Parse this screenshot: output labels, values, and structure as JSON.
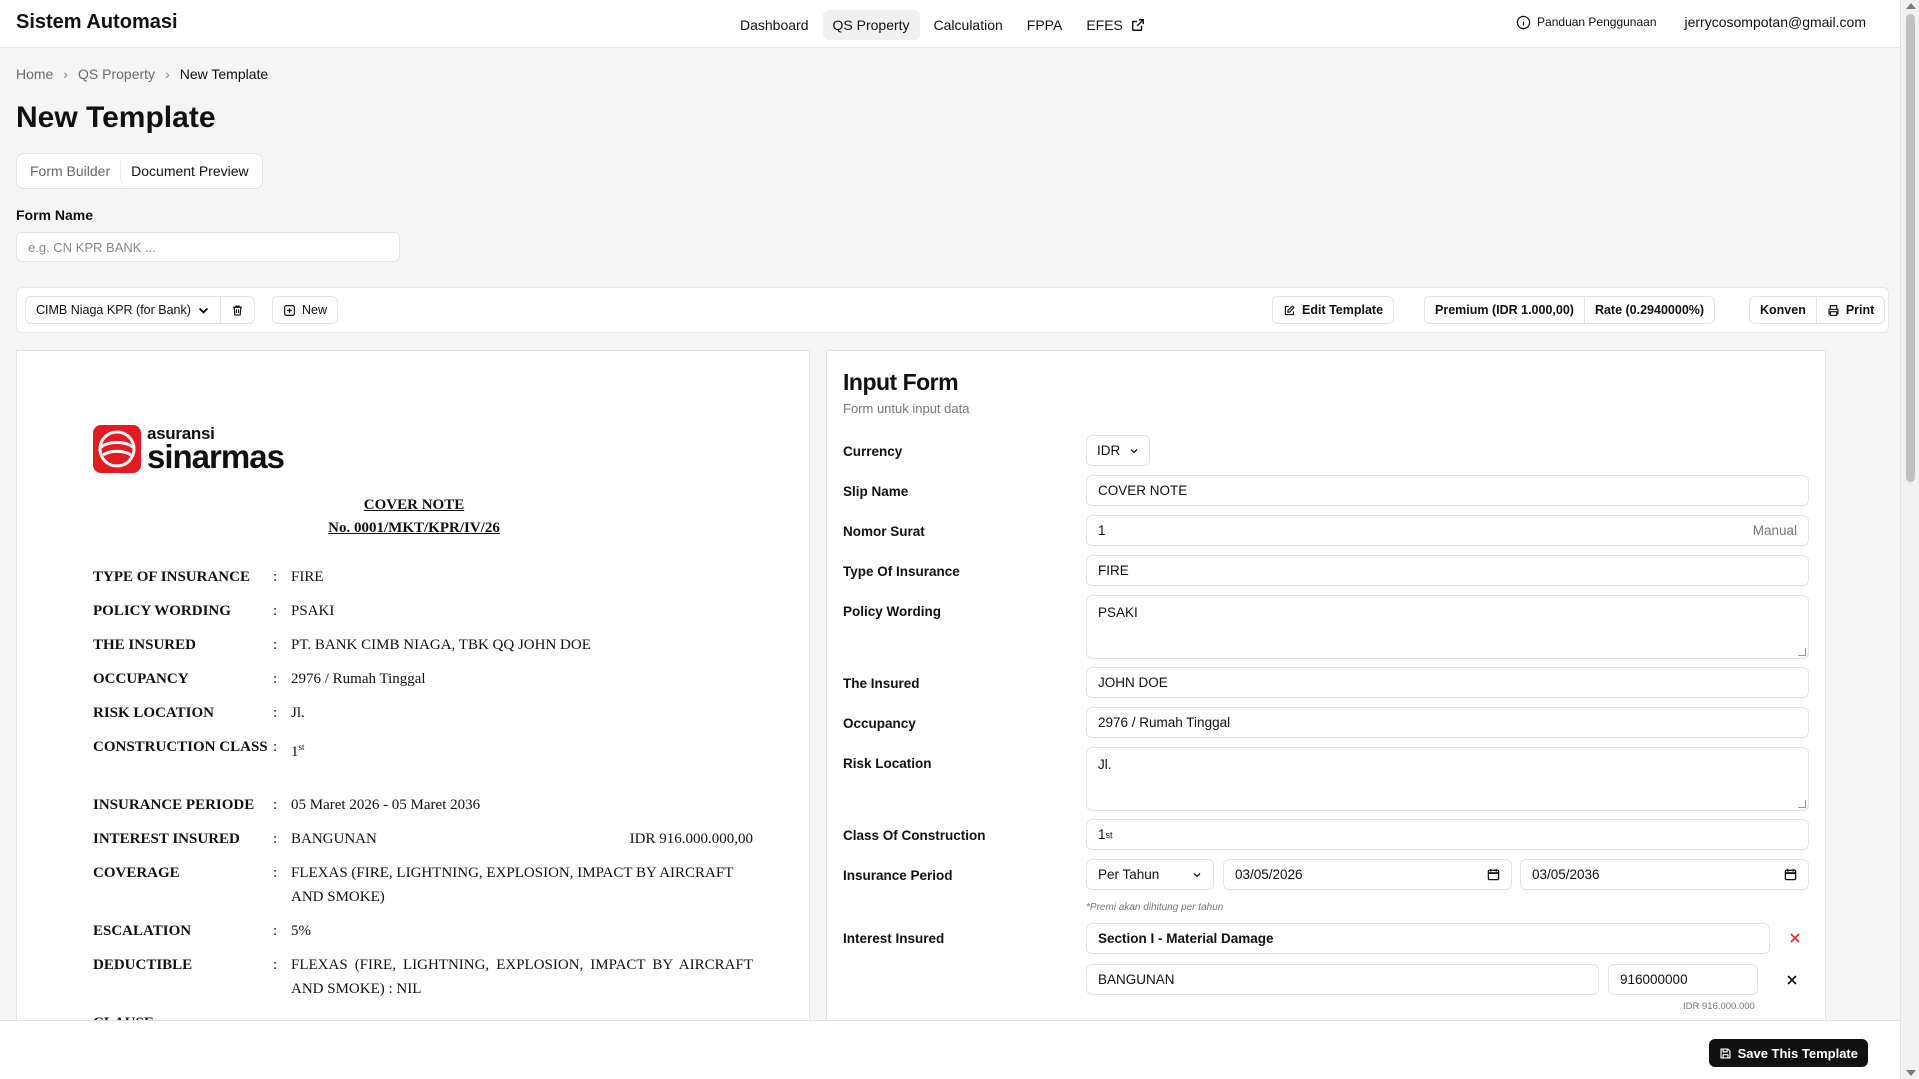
{
  "app": {
    "brand": "Sistem Automasi",
    "nav": [
      {
        "label": "Dashboard"
      },
      {
        "label": "QS Property"
      },
      {
        "label": "Calculation"
      },
      {
        "label": "FPPA"
      },
      {
        "label": "EFES"
      }
    ],
    "guide": "Panduan Penggunaan",
    "user": "jerrycosompotan@gmail.com"
  },
  "breadcrumb": [
    "Home",
    "QS Property",
    "New Template"
  ],
  "page_title": "New Template",
  "tabs": [
    "Form Builder",
    "Document Preview"
  ],
  "form_name": {
    "label": "Form Name",
    "placeholder": "e.g. CN KPR BANK ..."
  },
  "toolbar": {
    "template_select": "CIMB Niaga KPR (for Bank)",
    "new": "New",
    "edit": "Edit Template",
    "premium": "Premium (IDR 1.000,00)",
    "rate": "Rate (0.2940000%)",
    "konven": "Konven",
    "print": "Print"
  },
  "document": {
    "logo_small": "asuransi",
    "logo_big": "sinarmas",
    "heading": "COVER NOTE",
    "number": "No. 0001/MKT/KPR/IV/26",
    "rows": {
      "type": {
        "k": "TYPE OF INSURANCE",
        "v": "FIRE"
      },
      "wording": {
        "k": "POLICY WORDING",
        "v": "PSAKI"
      },
      "insured": {
        "k": "THE INSURED",
        "v": "PT. BANK CIMB NIAGA, TBK QQ JOHN DOE"
      },
      "occupancy": {
        "k": "OCCUPANCY",
        "v": "2976 / Rumah Tinggal"
      },
      "risk": {
        "k": "RISK LOCATION",
        "v": "Jl."
      },
      "construction": {
        "k": "CONSTRUCTION CLASS",
        "v": "1",
        "sup": "st"
      },
      "periode": {
        "k": "INSURANCE PERIODE",
        "v": "05 Maret 2026 - 05 Maret 2036"
      },
      "interest": {
        "k": "INTEREST INSURED",
        "v": "BANGUNAN",
        "amount": "IDR 916.000.000,00"
      },
      "coverage": {
        "k": "COVERAGE",
        "v": "FLEXAS (FIRE, LIGHTNING, EXPLOSION, IMPACT BY AIRCRAFT AND SMOKE)"
      },
      "escalation": {
        "k": "ESCALATION",
        "v": "5%"
      },
      "deductible": {
        "k": "DEDUCTIBLE",
        "v": "FLEXAS (FIRE, LIGHTNING, EXPLOSION, IMPACT BY AIRCRAFT AND SMOKE) : NIL"
      },
      "clause": {
        "k": "CLAUSE",
        "v": ""
      }
    }
  },
  "input_form": {
    "title": "Input Form",
    "subtitle": "Form untuk input data",
    "labels": {
      "currency": "Currency",
      "slip": "Slip Name",
      "nomor": "Nomor Surat",
      "type": "Type Of Insurance",
      "wording": "Policy Wording",
      "insured": "The Insured",
      "occupancy": "Occupancy",
      "risk": "Risk Location",
      "class": "Class Of Construction",
      "period": "Insurance Period",
      "interest": "Interest Insured"
    },
    "values": {
      "currency": "IDR",
      "slip": "COVER NOTE",
      "nomor": "1",
      "nomor_suffix": "Manual",
      "type": "FIRE",
      "wording": "PSAKI",
      "insured": "JOHN DOE",
      "occupancy": "2976 / Rumah Tinggal",
      "risk": "Jl.",
      "class": "1",
      "class_sup": "st",
      "period_mode": "Per Tahun",
      "start": "03/05/2026",
      "end": "03/05/2036",
      "period_note": "*Premi akan dihitung per tahun",
      "section": "Section I - Material Damage",
      "item_name": "BANGUNAN",
      "item_amount": "916000000",
      "item_amount_fmt": "IDR 916.000.000"
    }
  },
  "save_button": "Save This Template"
}
